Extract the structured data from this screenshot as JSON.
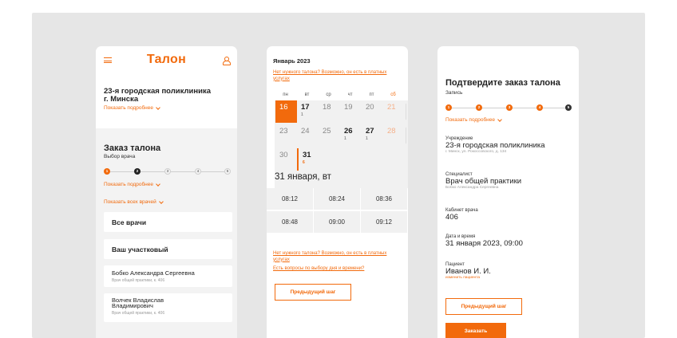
{
  "colors": {
    "accent": "#f26a0c",
    "bg": "#e6e6e6"
  },
  "screen1": {
    "logo": "Талон",
    "menu_icon": "hamburger-icon",
    "user_icon": "user-icon",
    "clinic_line1": "23-я городская поликлиника",
    "clinic_line2": "г. Минска",
    "show_more": "Показать подробнее",
    "order_title": "Заказ талона",
    "order_subtitle": "Выбор врача",
    "steps": [
      "1",
      "2",
      "3",
      "4",
      "5"
    ],
    "show_more2": "Показать подробнее",
    "show_all_doctors": "Показать всех врачей",
    "all_doctors": "Все врачи",
    "your_doctor": "Ваш участковый",
    "doctors": [
      {
        "name_line1": "Бобко Александра Сергеевна",
        "name_line2": "",
        "spec": "Врач общей практики, к. 406"
      },
      {
        "name_line1": "Волчек Владислав",
        "name_line2": "Владимирович",
        "spec": "Врач общей практики, к. 406"
      }
    ]
  },
  "screen2": {
    "month": "Январь 2023",
    "no_ticket": "Нет нужного талона? Возможно, он есть в платных услугах",
    "weekdays": [
      "пн",
      "вт",
      "ср",
      "чт",
      "пт",
      "сб"
    ],
    "days": [
      {
        "d": "16",
        "c": ""
      },
      {
        "d": "17",
        "c": "1"
      },
      {
        "d": "18",
        "c": ""
      },
      {
        "d": "19",
        "c": ""
      },
      {
        "d": "20",
        "c": ""
      },
      {
        "d": "21",
        "c": ""
      },
      {
        "d": "23",
        "c": ""
      },
      {
        "d": "24",
        "c": ""
      },
      {
        "d": "25",
        "c": ""
      },
      {
        "d": "26",
        "c": "1"
      },
      {
        "d": "27",
        "c": "1"
      },
      {
        "d": "28",
        "c": ""
      },
      {
        "d": "30",
        "c": ""
      },
      {
        "d": "31",
        "c": "6"
      }
    ],
    "selected_date": "31 января, вт",
    "times": [
      "08:12",
      "08:24",
      "08:36",
      "08:48",
      "09:00",
      "09:12"
    ],
    "no_ticket2": "Нет нужного талона? Возможно, он есть в платных услугах",
    "questions": "Есть вопросы по выбору дня и времени?",
    "prev_button": "Предыдущий шаг"
  },
  "screen3": {
    "title": "Подтвердите заказ талона",
    "subtitle": "Запись",
    "steps": [
      "1",
      "2",
      "3",
      "4",
      "5"
    ],
    "show_more": "Показать подробнее",
    "institution_label": "Учреждение",
    "institution": "23-я городская поликлиника",
    "institution_addr": "г. Минск, ул. Рокоссовского, д. 134",
    "specialist_label": "Специалист",
    "specialist": "Врач общей практики",
    "specialist_name": "Бобко Александра Сергеевна",
    "cabinet_label": "Кабинет врача",
    "cabinet": "406",
    "datetime_label": "Дата и время",
    "datetime": "31 января 2023, 09:00",
    "patient_label": "Пациент",
    "patient": "Иванов И. И.",
    "change_patient": "изменить пациента",
    "prev_button": "Предыдущий шаг",
    "order_button": "Заказать"
  }
}
